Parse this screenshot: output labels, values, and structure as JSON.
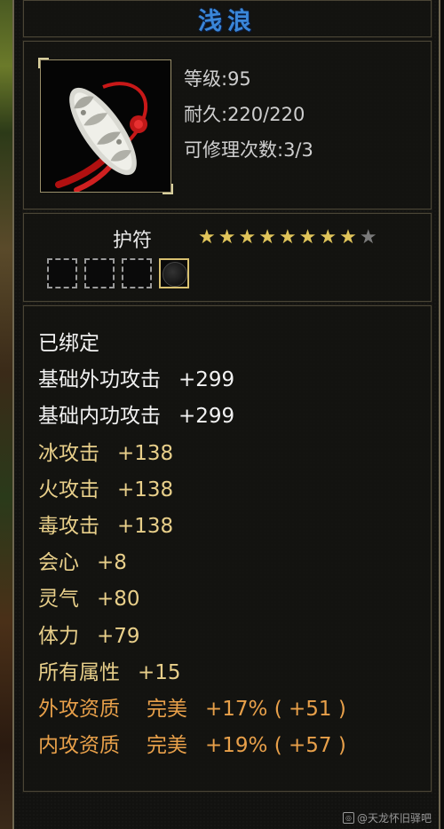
{
  "item": {
    "name": "浅浪",
    "level_text": "等级:95",
    "durability_text": "耐久:220/220",
    "repair_text": "可修理次数:3/3"
  },
  "slot": {
    "label": "护符",
    "stars_filled": 8,
    "stars_total": 9,
    "sockets": [
      "empty",
      "empty",
      "empty",
      "filled"
    ]
  },
  "attributes": [
    {
      "name": "已绑定",
      "value": "",
      "quality": "",
      "color": "white"
    },
    {
      "name": "基础外功攻击",
      "value": "+299",
      "quality": "",
      "color": "white"
    },
    {
      "name": "基础内功攻击",
      "value": "+299",
      "quality": "",
      "color": "white"
    },
    {
      "name": "冰攻击",
      "value": "+138",
      "quality": "",
      "color": "gold"
    },
    {
      "name": "火攻击",
      "value": "+138",
      "quality": "",
      "color": "gold"
    },
    {
      "name": "毒攻击",
      "value": "+138",
      "quality": "",
      "color": "gold"
    },
    {
      "name": "会心",
      "value": "+8",
      "quality": "",
      "color": "gold"
    },
    {
      "name": "灵气",
      "value": "+80",
      "quality": "",
      "color": "gold"
    },
    {
      "name": "体力",
      "value": "+79",
      "quality": "",
      "color": "gold"
    },
    {
      "name": "所有属性",
      "value": "+15",
      "quality": "",
      "color": "gold"
    },
    {
      "name": "外攻资质",
      "value": "+17% ( +51 )",
      "quality": "完美",
      "color": "orange"
    },
    {
      "name": "内攻资质",
      "value": "+19% ( +57 )",
      "quality": "完美",
      "color": "orange"
    }
  ],
  "watermark": "@天龙怀旧驿吧",
  "colors": {
    "title": "#3a86d8",
    "gold": "#e8cf8a",
    "orange": "#e8a04a",
    "white": "#f2f2f2",
    "star_filled": "#e0c45a",
    "star_empty": "#7a7a7a"
  }
}
